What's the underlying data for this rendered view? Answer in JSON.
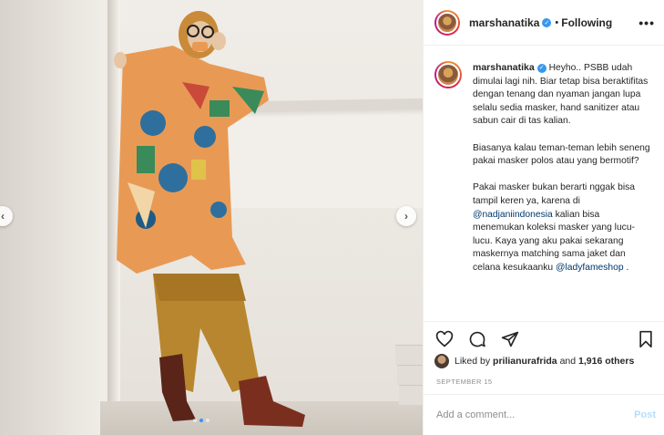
{
  "post": {
    "username": "marshanatika",
    "verified": true,
    "follow_status": "Following",
    "separator": "•"
  },
  "caption": {
    "greeting": "Heyho..",
    "paragraph1": "PSBB udah dimulai lagi nih. Biar tetap bisa beraktifitas dengan tenang dan nyaman jangan lupa selalu sedia masker, hand sanitizer atau sabun cair di tas kalian.",
    "paragraph2": "Biasanya kalau teman-teman lebih seneng pakai masker polos atau yang bermotif?",
    "paragraph3_a": "Pakai masker bukan berarti nggak bisa tampil keren ya, karena di",
    "mention1": "@nadjaniindonesia",
    "paragraph3_b": "kalian bisa menemukan koleksi masker yang lucu-lucu. Kaya yang aku pakai sekarang maskernya matching sama jaket dan celana kesukaanku",
    "mention2": "@ladyfameshop",
    "trailing": "."
  },
  "likes": {
    "prefix": "Liked by",
    "user": "prilianurafrida",
    "connector": "and",
    "others": "1,916 others"
  },
  "date": "SEPTEMBER 15",
  "comment": {
    "placeholder": "Add a comment...",
    "post_label": "Post"
  },
  "carousel": {
    "slide_count": 3,
    "active_index": 1
  },
  "icons": {
    "more": "more-options-icon",
    "like": "heart-icon",
    "comment": "comment-icon",
    "share": "share-icon",
    "save": "bookmark-icon",
    "verified": "verified-badge-icon",
    "prev": "chevron-left-icon",
    "next": "chevron-right-icon"
  },
  "colors": {
    "accent": "#3897f0",
    "mention": "#00376b",
    "muted": "#8e8e8e",
    "post_disabled": "#b2dffc"
  }
}
